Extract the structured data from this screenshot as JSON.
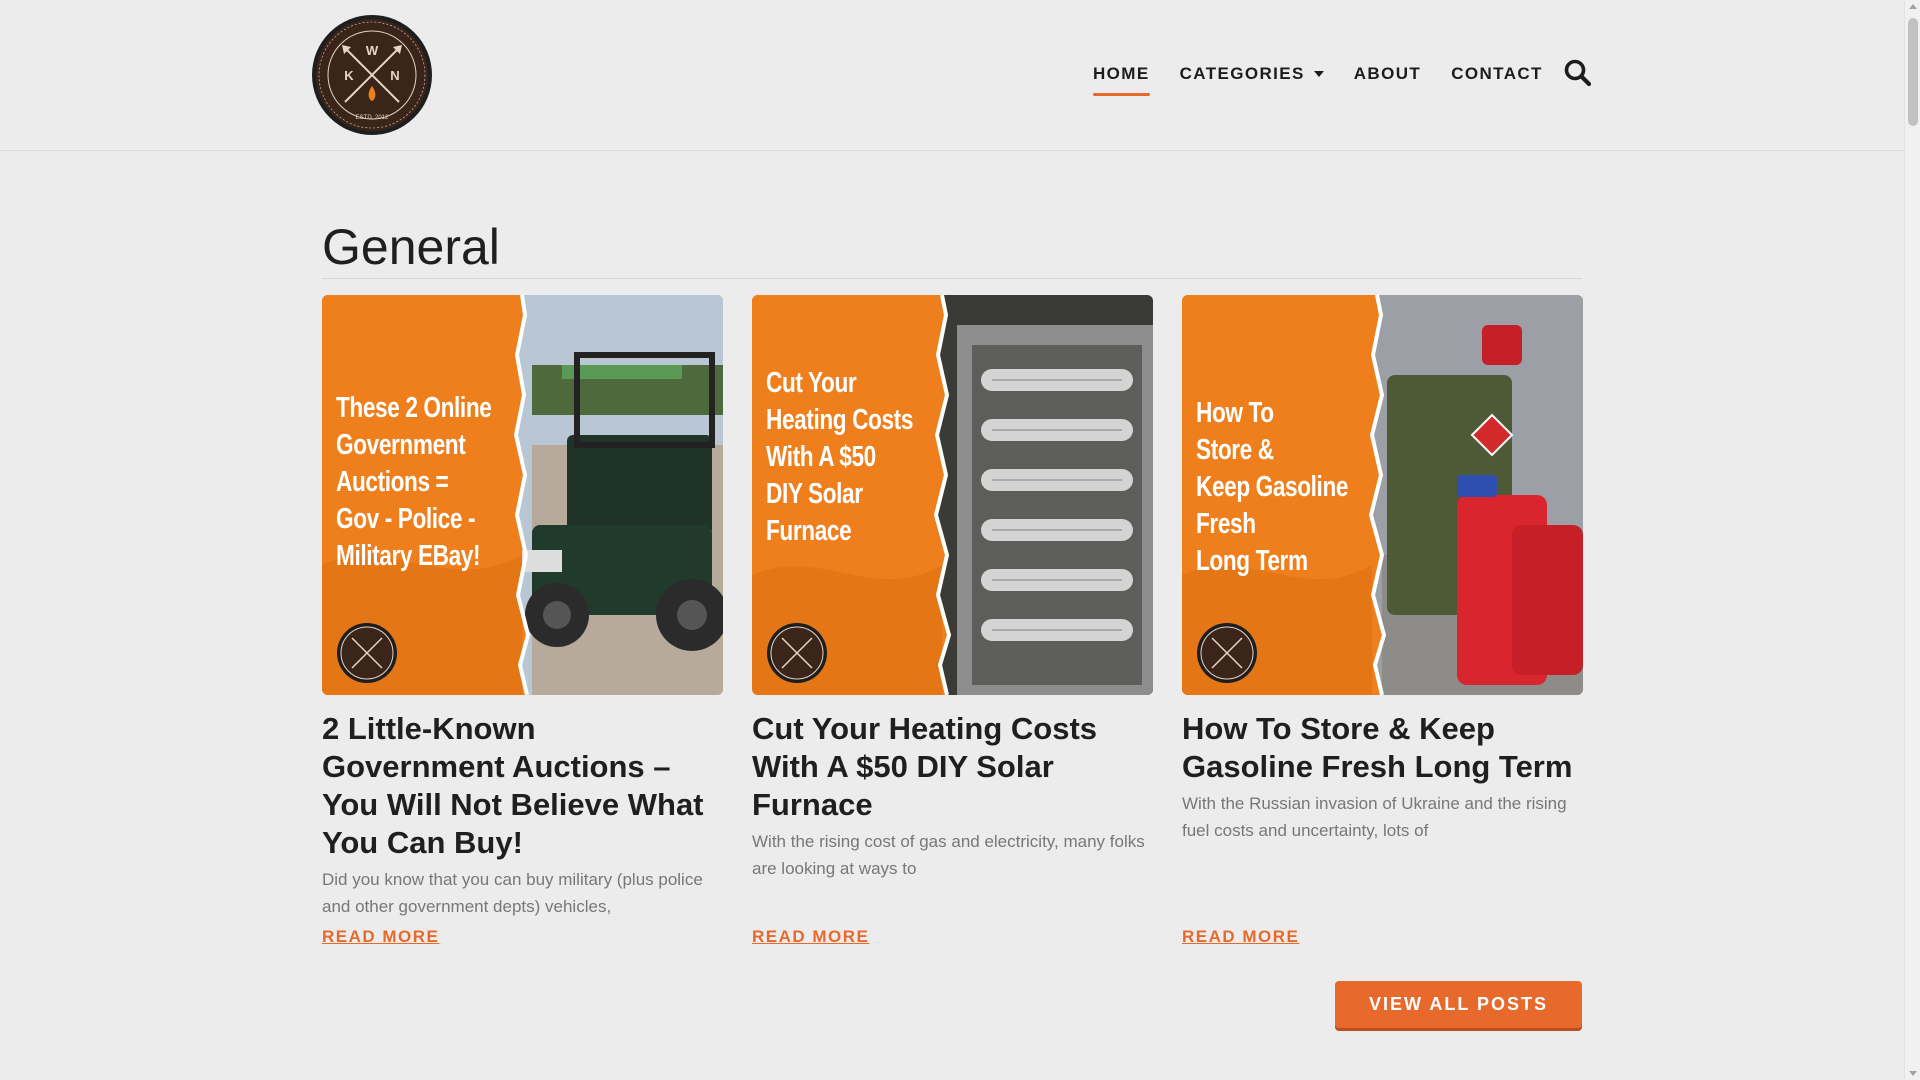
{
  "brand": {
    "logo_letters": [
      "W",
      "K",
      "N"
    ],
    "logo_ring_text": "Homesteading | Survival | Prepping | Self-Sufficiency | DIY | Outdoors",
    "logo_est": "ESTD. 2012",
    "accent": "#e8692c",
    "orange": "#ee7f1c"
  },
  "nav": {
    "items": [
      {
        "label": "HOME",
        "active": true
      },
      {
        "label": "CATEGORIES",
        "dropdown": true
      },
      {
        "label": "ABOUT"
      },
      {
        "label": "CONTACT"
      }
    ],
    "search_icon": "search-icon"
  },
  "section": {
    "title": "General"
  },
  "posts": [
    {
      "thumb_lines": [
        "These 2 Online",
        "Government",
        "Auctions =",
        "Gov - Police -",
        "Military EBay!"
      ],
      "title": "2 Little-Known Government Auctions – You Will Not Believe What You Can Buy!",
      "excerpt": "Did you know that you can buy military (plus police and other government depts) vehicles,",
      "read_more": "READ MORE",
      "image": "utility-vehicle"
    },
    {
      "thumb_lines": [
        "Cut Your",
        "Heating Costs",
        "With A $50",
        "DIY Solar",
        "Furnace"
      ],
      "title": "Cut Your Heating Costs With A $50 DIY Solar Furnace",
      "excerpt": "With the rising cost of gas and electricity, many folks are looking at ways to",
      "read_more": "READ MORE",
      "image": "solar-furnace-duct"
    },
    {
      "thumb_lines": [
        "How To",
        "Store &",
        "Keep Gasoline",
        "Fresh",
        "Long Term"
      ],
      "title": "How To Store & Keep Gasoline Fresh Long Term",
      "excerpt": "With the Russian invasion of Ukraine and the rising fuel costs and uncertainty, lots of",
      "read_more": "READ MORE",
      "image": "gas-cans"
    }
  ],
  "view_all": "VIEW ALL POSTS"
}
